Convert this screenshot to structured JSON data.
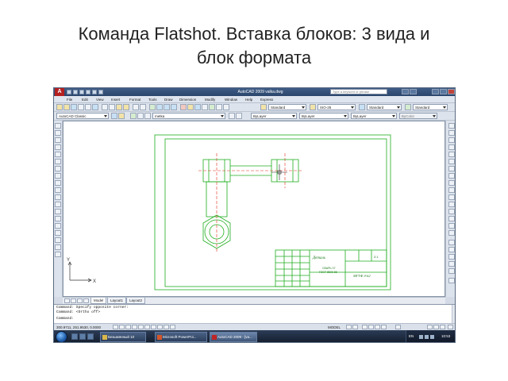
{
  "slide": {
    "title_line1": "Команда Flatshot. Вставка блоков: 3 вида и",
    "title_line2": "блок формата"
  },
  "window": {
    "title": "AutoCAD 2009 valka.dwg",
    "search_placeholder": "Type a keyword or phrase",
    "logo": "A"
  },
  "menu": [
    "File",
    "Edit",
    "View",
    "Insert",
    "Format",
    "Tools",
    "Draw",
    "Dimension",
    "Modify",
    "Window",
    "Help",
    "Express"
  ],
  "toolbar1": {
    "text_style": "Standard",
    "dim_style": "ISO-25",
    "table_style": "Standard",
    "mleader_style": "Standard"
  },
  "toolbar2": {
    "workspace": "AutoCAD Classic",
    "layer": "metka",
    "color": "ByLayer",
    "linetype": "ByLayer",
    "lineweight": "ByLayer",
    "plotstyle": "ByColor"
  },
  "drawing": {
    "title_block_name": "Деталь",
    "title_block_sheet": "2:1",
    "title_block_code1": "СВАРЬ 07",
    "title_block_code2": "ГОСТ 8509-86",
    "title_block_org": "МГТФ З-62",
    "ucs_x": "X",
    "ucs_y": "Y"
  },
  "layout_tabs": [
    "Model",
    "Layout1",
    "Layout2"
  ],
  "command_lines": [
    "Command: Specify opposite corner:",
    "Command: <Ortho off>",
    "Command:"
  ],
  "status": {
    "coords": "300.9711, 251.9530, 0.0000",
    "model": "MODEL"
  },
  "taskbar": {
    "tasks": [
      {
        "label": "Безымянный 10"
      },
      {
        "label": "Microsoft PowerPoi..."
      },
      {
        "label": "AutoCAD 2009 - [va..."
      }
    ],
    "lang": "EN",
    "time": "10:53"
  },
  "colors": {
    "drawing_lines": "#1fae1f",
    "centerline": "#e0301c",
    "cursor": "#222222",
    "titlebar": "#2a456c"
  }
}
